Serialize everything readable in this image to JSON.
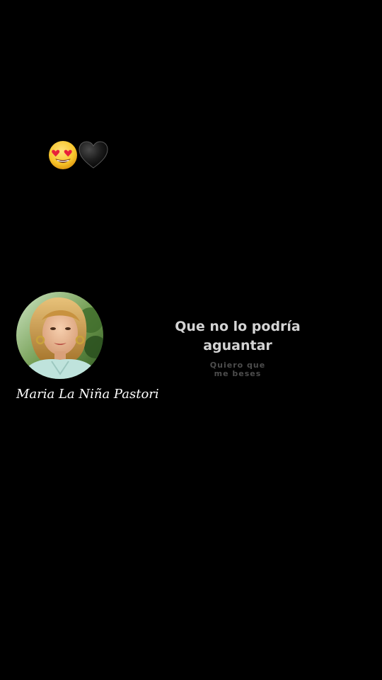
{
  "story": {
    "emojis": [
      "smiling-face-with-heart-eyes",
      "black-heart"
    ],
    "artist_name": "Maria La Niña Pastori",
    "lyrics": {
      "current": "Que no lo podría\naguantar",
      "next": "Quiero que\nme beses"
    }
  },
  "colors": {
    "background": "#000000",
    "current_lyric": "#d4d4d4",
    "next_lyric": "#4d4d4d",
    "artist_name": "#ffffff"
  }
}
